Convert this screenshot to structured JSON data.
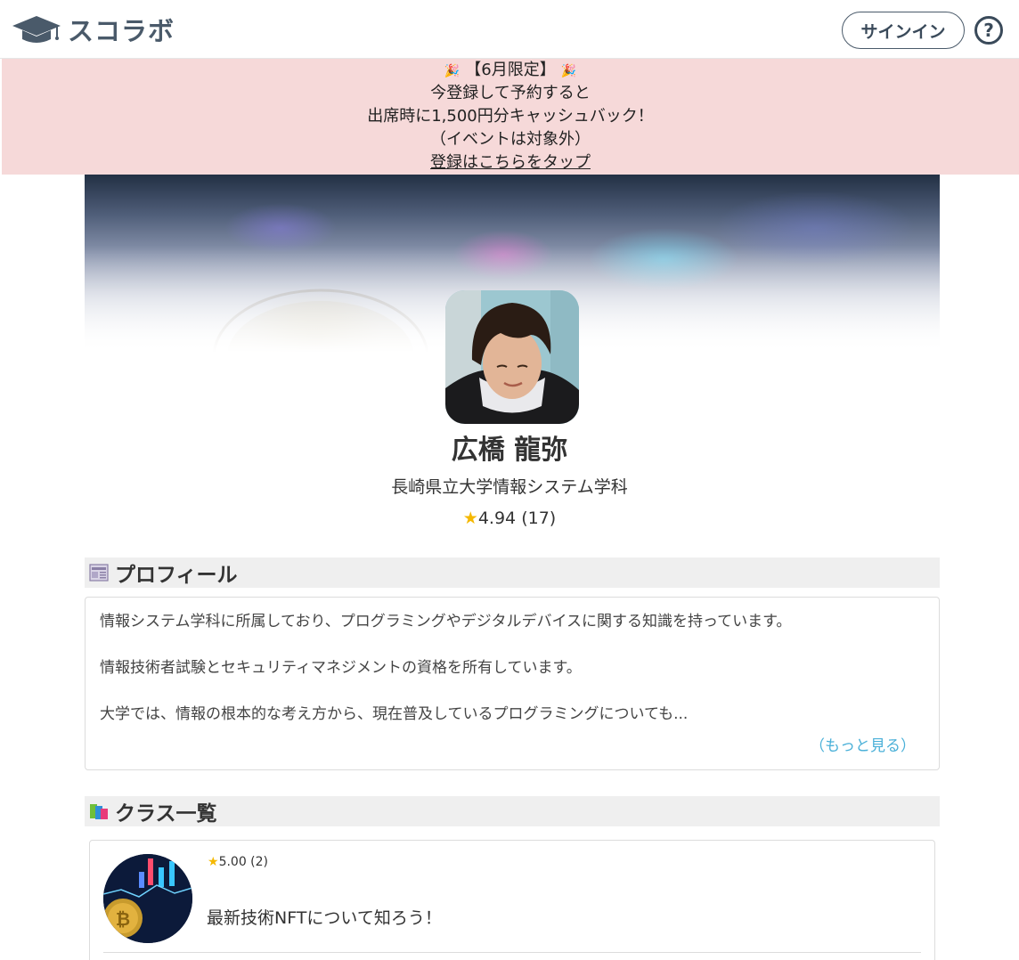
{
  "header": {
    "logo_text": "スコラボ",
    "signin_label": "サインイン",
    "help_label": "?"
  },
  "banner": {
    "line1": "【6月限定】",
    "line2": "今登録して予約すると",
    "line3": "出席時に1,500円分キャッシュバック！",
    "line4": "（イベントは対象外）",
    "link_text": "登録はこちらをタップ",
    "background_color": "#f6d9d9"
  },
  "profile": {
    "name": "広橋 龍弥",
    "school": "長崎県立大学情報システム学科",
    "rating_star": "★",
    "rating_text": "4.94 (17)"
  },
  "sections": {
    "profile_title": "プロフィール",
    "profile_icon": "newspaper-icon",
    "classes_title": "クラス一覧",
    "classes_icon": "books-icon"
  },
  "profile_text": {
    "p1": "情報システム学科に所属しており、プログラミングやデジタルデバイスに関する知識を持っています。",
    "p2": "情報技術者試験とセキュリティマネジメントの資格を所有しています。",
    "p3": "大学では、情報の根本的な考え方から、現在普及しているプログラミングについても...",
    "more": "（もっと見る）",
    "more_color": "#4ab0d8"
  },
  "classes": [
    {
      "rating_star": "★",
      "rating": "5.00 (2)",
      "title": "最新技術NFTについて知ろう！"
    }
  ]
}
